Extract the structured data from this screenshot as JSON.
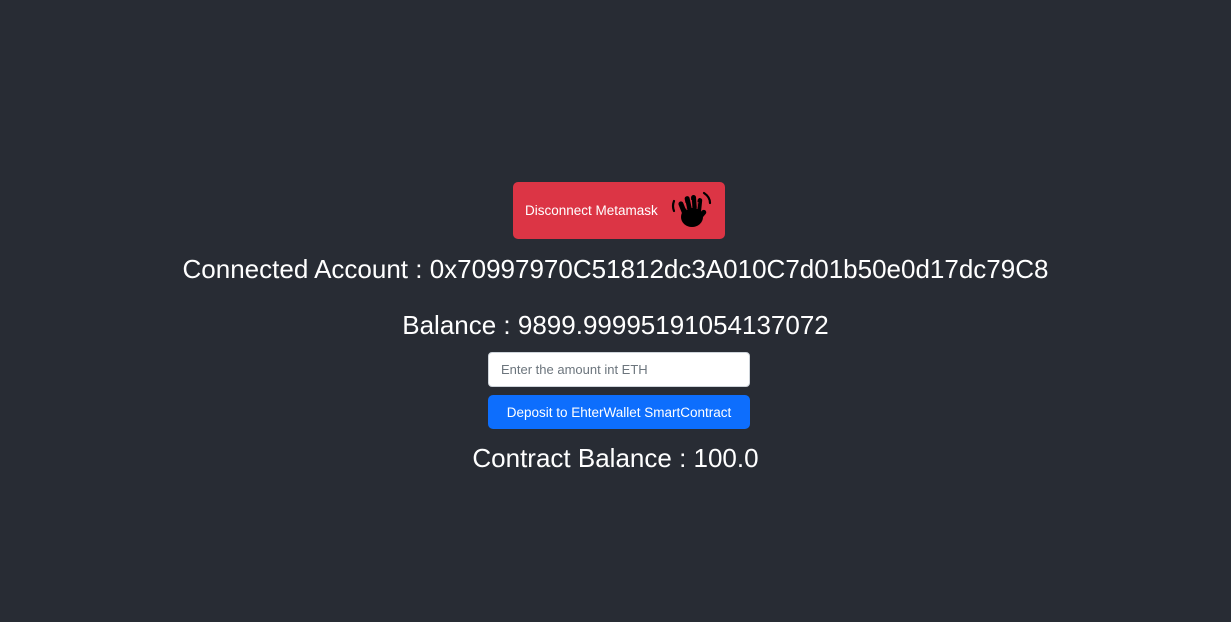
{
  "disconnect_button": {
    "label": "Disconnect Metamask",
    "icon": "waving-hand-icon",
    "color": "#dc3545"
  },
  "account": {
    "label": "Connected Account",
    "separator": " : ",
    "address": "0x70997970C51812dc3A010C7d01b50e0d17dc79C8"
  },
  "balance": {
    "label": "Balance",
    "separator": " : ",
    "value": "9899.99995191054137072"
  },
  "deposit": {
    "amount_value": "",
    "amount_placeholder": "Enter the amount int ETH",
    "button_label": "Deposit to EhterWallet SmartContract",
    "button_color": "#0d6efd"
  },
  "contract_balance": {
    "label": "Contract Balance",
    "separator": " : ",
    "value": "100.0"
  },
  "theme": {
    "background": "#282c34",
    "text": "#ffffff"
  }
}
